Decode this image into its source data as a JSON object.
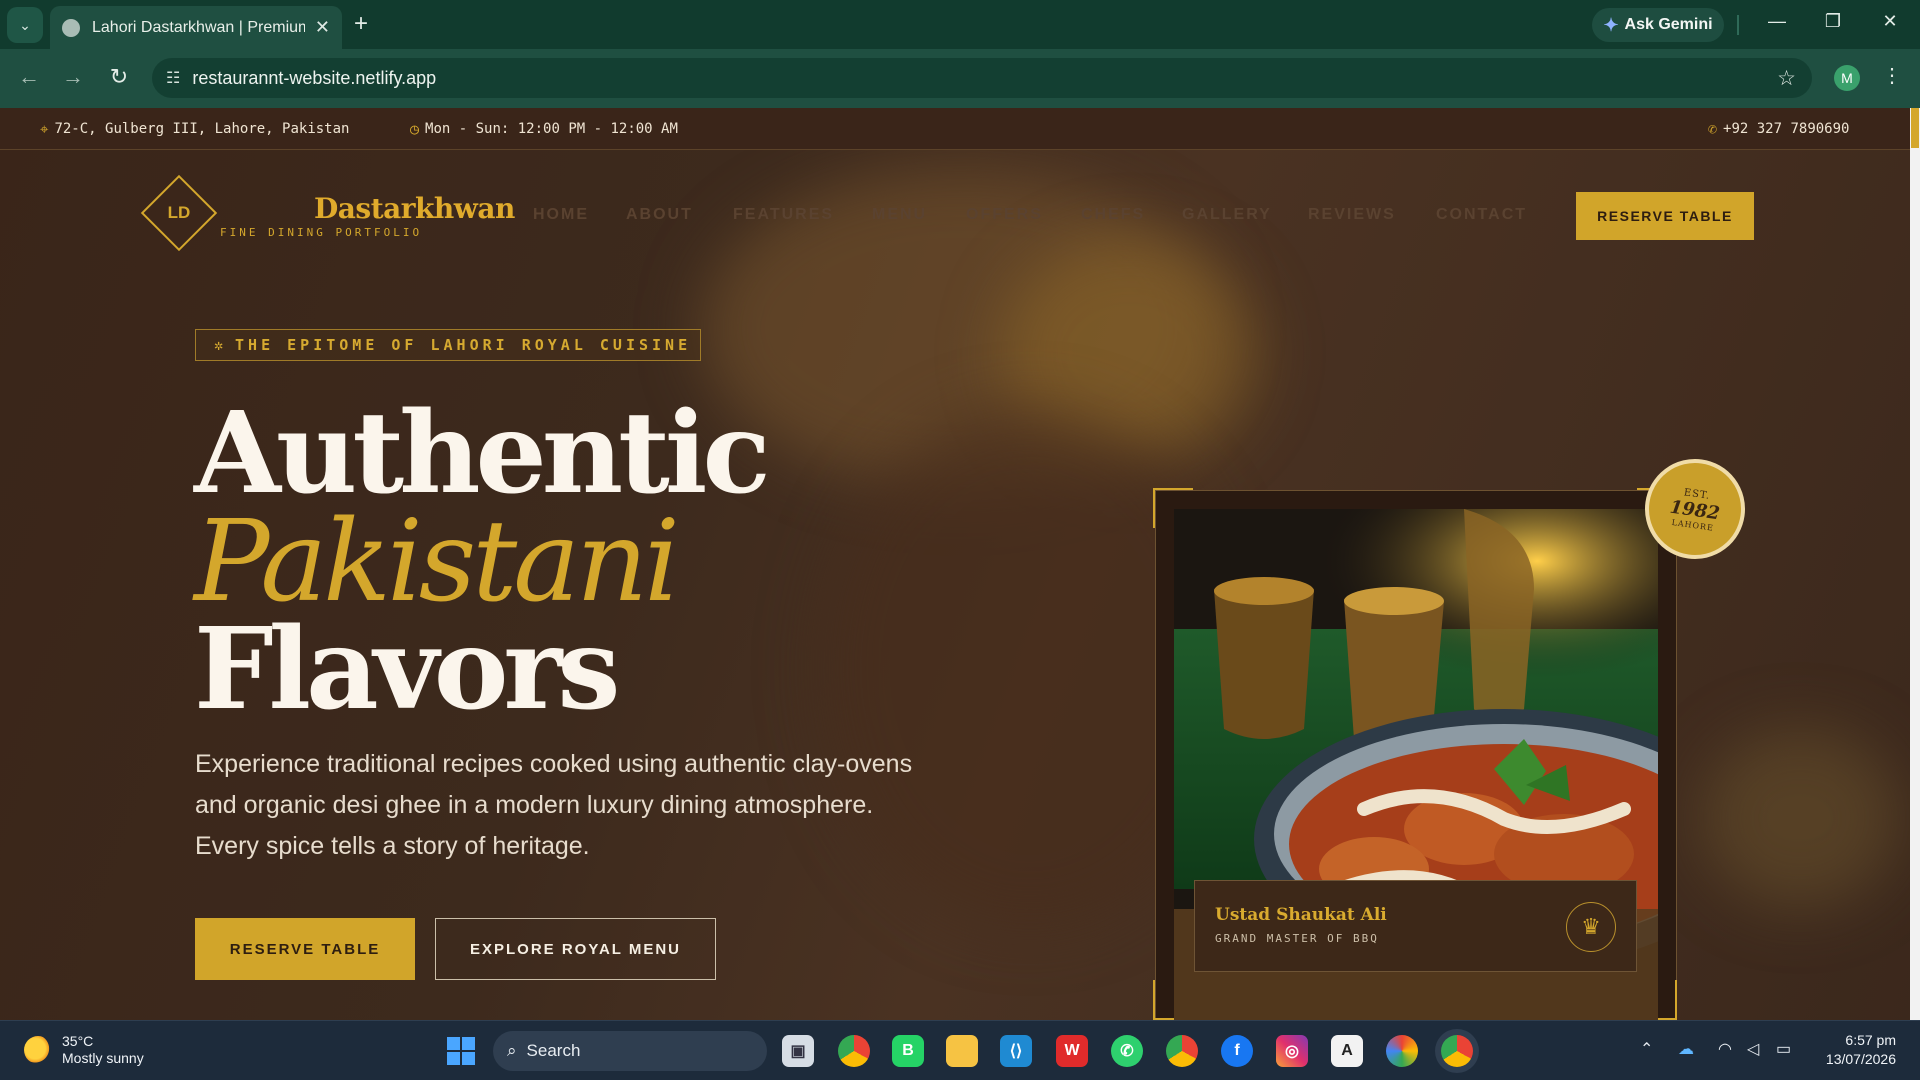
{
  "browser": {
    "tab_title": "Lahori Dastarkhwan | Premium",
    "tab_close": "✕",
    "new_tab": "+",
    "gemini_label": "Ask Gemini",
    "url": "restaurannt-website.netlify.app",
    "profile_initial": "M"
  },
  "site": {
    "topbar": {
      "address": "72-C, Gulberg III, Lahore, Pakistan",
      "hours": "Mon - Sun: 12:00 PM - 12:00 AM",
      "phone": "+92 327 7890690"
    },
    "logo_initials": "LD",
    "brand_name": "Dastarkhwan",
    "brand_subtitle": "FINE DINING PORTFOLIO",
    "nav": [
      "HOME",
      "ABOUT",
      "FEATURES",
      "MENU",
      "OFFERS",
      "CHEFS",
      "GALLERY",
      "REVIEWS",
      "CONTACT"
    ],
    "nav_cta": "RESERVE TABLE",
    "hero": {
      "tagline": "THE EPITOME OF LAHORI ROYAL CUISINE",
      "title_line1": "Authentic",
      "title_line2": "Pakistani",
      "title_line3": "Flavors",
      "description": "Experience traditional recipes cooked using authentic clay-ovens and organic desi ghee in a modern luxury dining atmosphere. Every spice tells a story of heritage.",
      "primary_button": "RESERVE TABLE",
      "secondary_button": "EXPLORE ROYAL MENU"
    },
    "badge": {
      "line1": "EST.",
      "year": "1982",
      "line3": "LAHORE"
    },
    "chef_card": {
      "name": "Ustad Shaukat Ali",
      "role": "GRAND MASTER OF BBQ"
    }
  },
  "taskbar": {
    "weather_temp": "35°C",
    "weather_desc": "Mostly sunny",
    "search_label": "Search",
    "time": "6:57 pm",
    "date": "13/07/2026"
  },
  "colors": {
    "gold": "#d4a72c",
    "brown": "#3a2519",
    "browser_green": "#1f4f41",
    "taskbar": "#1d2b3b"
  },
  "icons": [
    "tab-search-icon",
    "globe-icon",
    "close-icon",
    "plus-icon",
    "gemini-icon",
    "minimize-icon",
    "restore-icon",
    "window-close-icon",
    "back-icon",
    "forward-icon",
    "reload-icon",
    "site-settings-icon",
    "bookmark-star-icon",
    "kebab-menu-icon",
    "location-pin-icon",
    "clock-icon",
    "phone-icon",
    "medal-icon",
    "award-icon",
    "weather-icon",
    "windows-start-icon",
    "search-icon"
  ]
}
